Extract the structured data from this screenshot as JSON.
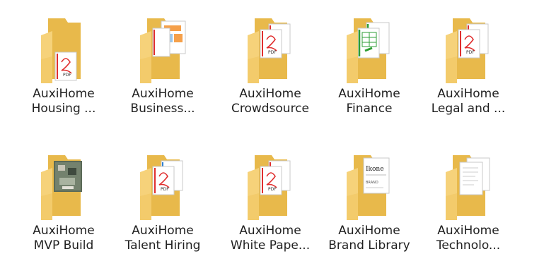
{
  "folders": [
    {
      "line1": "AuxiHome",
      "line2": "Housing ...",
      "icon": "pdf-folder-icon",
      "variant": "pdf-partial"
    },
    {
      "line1": "AuxiHome",
      "line2": "Business...",
      "icon": "brochure-folder-icon",
      "variant": "brochure-partial"
    },
    {
      "line1": "AuxiHome",
      "line2": "Crowdsource",
      "icon": "pdf-folder-icon",
      "variant": "pdf"
    },
    {
      "line1": "AuxiHome",
      "line2": "Finance",
      "icon": "spreadsheet-folder-icon",
      "variant": "sheet"
    },
    {
      "line1": "AuxiHome",
      "line2": "Legal and ...",
      "icon": "pdf-folder-icon",
      "variant": "pdf"
    },
    {
      "line1": "AuxiHome",
      "line2": "MVP Build",
      "icon": "photo-folder-icon",
      "variant": "photo"
    },
    {
      "line1": "AuxiHome",
      "line2": "Talent Hiring",
      "icon": "pdf-folder-icon",
      "variant": "pdf-blue"
    },
    {
      "line1": "AuxiHome",
      "line2": "White Pape...",
      "icon": "pdf-folder-icon",
      "variant": "pdf"
    },
    {
      "line1": "AuxiHome",
      "line2": "Brand Library",
      "icon": "brand-doc-folder-icon",
      "variant": "brand"
    },
    {
      "line1": "AuxiHome",
      "line2": "Technolo...",
      "icon": "document-folder-icon",
      "variant": "doc"
    }
  ],
  "colors": {
    "folder_back": "#e8b94b",
    "folder_front": "#f6d27a",
    "pdf_red": "#e02f2f",
    "sheet_green": "#2e9e34"
  }
}
